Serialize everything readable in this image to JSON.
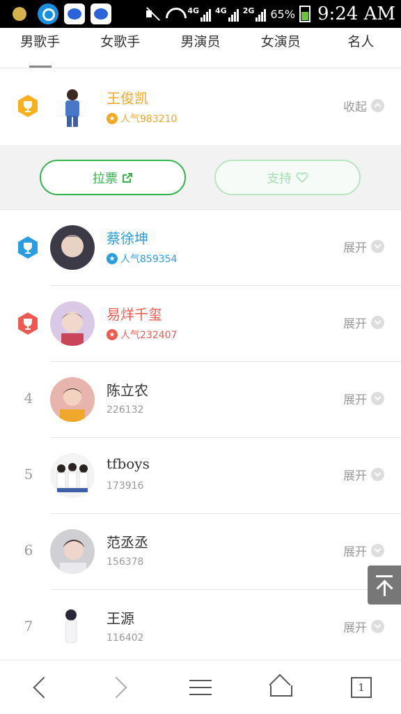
{
  "status_bar": {
    "network_1": "4G",
    "network_2": "4G",
    "network_3": "2G",
    "battery": "65%",
    "time": "9:24 AM",
    "icons": [
      "notification-dot-icon",
      "browser-app-icon",
      "baidu-icon",
      "baidu-icon",
      "mute-icon",
      "wifi-icon",
      "signal-icon",
      "battery-icon"
    ]
  },
  "tabs": [
    {
      "label": "男歌手",
      "active": true
    },
    {
      "label": "女歌手",
      "active": false
    },
    {
      "label": "男演员",
      "active": false
    },
    {
      "label": "女演员",
      "active": false
    },
    {
      "label": "名人",
      "active": false
    }
  ],
  "list": [
    {
      "rank": "1",
      "name": "王俊凯",
      "popularity": "人气983210",
      "toggle": "收起",
      "color": "#f5a623",
      "expanded": true
    },
    {
      "rank": "2",
      "name": "蔡徐坤",
      "popularity": "人气859354",
      "toggle": "展开",
      "color": "#2a9ce0"
    },
    {
      "rank": "3",
      "name": "易烊千玺",
      "popularity": "人气232407",
      "toggle": "展开",
      "color": "#ef5a50"
    },
    {
      "rank": "4",
      "name": "陈立农",
      "score": "226132",
      "toggle": "展开"
    },
    {
      "rank": "5",
      "name": "tfboys",
      "score": "173916",
      "toggle": "展开"
    },
    {
      "rank": "6",
      "name": "范丞丞",
      "score": "156378",
      "toggle": "展开"
    },
    {
      "rank": "7",
      "name": "王源",
      "score": "116402",
      "toggle": "展开"
    }
  ],
  "actions": {
    "vote_label": "拉票",
    "support_label": "支持"
  },
  "bottom_nav": {
    "tab_count": "1"
  }
}
